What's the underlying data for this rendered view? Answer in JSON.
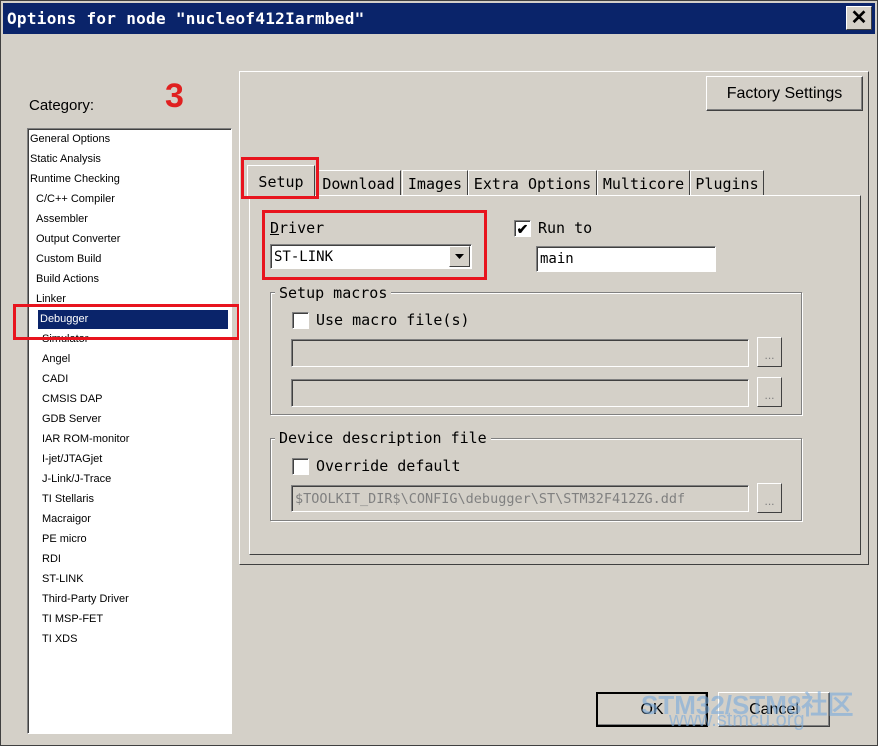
{
  "window": {
    "title": "Options for node \"nucleof412Iarmbed\"",
    "close_glyph": "✕"
  },
  "annotation": {
    "step_number": "3",
    "color": "#e8141e"
  },
  "category": {
    "label": "Category:",
    "items": [
      "General Options",
      "Static Analysis",
      "Runtime Checking",
      "C/C++ Compiler",
      "Assembler",
      "Output Converter",
      "Custom Build",
      "Build Actions",
      "Linker",
      "Debugger",
      "Simulator",
      "Angel",
      "CADI",
      "CMSIS DAP",
      "GDB Server",
      "IAR ROM-monitor",
      "I-jet/JTAGjet",
      "J-Link/J-Trace",
      "TI Stellaris",
      "Macraigor",
      "PE micro",
      "RDI",
      "ST-LINK",
      "Third-Party Driver",
      "TI MSP-FET",
      "TI XDS"
    ],
    "selected": "Debugger"
  },
  "factory_settings_label": "Factory Settings",
  "tabs": [
    "Setup",
    "Download",
    "Images",
    "Extra Options",
    "Multicore",
    "Plugins"
  ],
  "active_tab": "Setup",
  "setup": {
    "driver_label": "Driver",
    "driver_value": "ST-LINK",
    "run_to_label": "Run to",
    "run_to_checked": true,
    "run_to_value": "main",
    "setup_macros_title": "Setup macros",
    "use_macro_label": "Use macro file(s)",
    "use_macro_checked": false,
    "macro_file_1": "",
    "macro_file_2": "",
    "ellipsis_label": "...",
    "device_desc_title": "Device description file",
    "override_label": "Override default",
    "override_checked": false,
    "device_desc_path": "$TOOLKIT_DIR$\\CONFIG\\debugger\\ST\\STM32F412ZG.ddf"
  },
  "buttons": {
    "ok": "OK",
    "cancel": "Cancel"
  },
  "watermark": {
    "line1": "STM32/STM8社区",
    "line2": "www.stmcu.org"
  }
}
